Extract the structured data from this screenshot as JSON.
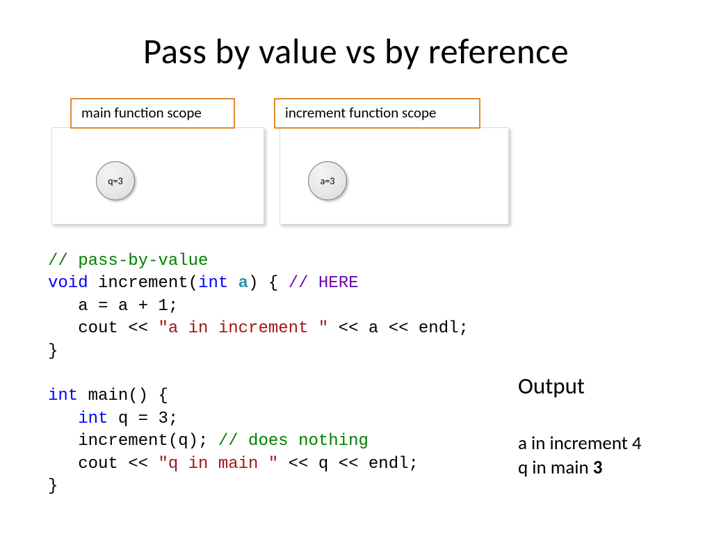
{
  "title": "Pass by value vs by reference",
  "scope_left": {
    "label": "main function scope",
    "var": "q=3"
  },
  "scope_right": {
    "label": "increment function scope",
    "var": "a=3"
  },
  "code": {
    "comment_pbv": "// pass-by-value",
    "kw_void": "void",
    "fn_increment": " increment(",
    "kw_int_a": "int",
    "param_a": " a",
    "paren_open": ") { ",
    "comment_here": "// HERE",
    "line_assign": "   a = a + 1;",
    "line_cout1a": "   cout << ",
    "line_cout1str": "\"a in increment \"",
    "line_cout1b": " << a << endl;",
    "brace1": "}",
    "kw_int_main": "int",
    "fn_main": " main() {",
    "line_intq_a": "   ",
    "line_intq_kw": "int",
    "line_intq_b": " q = 3;",
    "line_call_a": "   increment(q); ",
    "line_call_c": "// does nothing",
    "line_cout2a": "   cout << ",
    "line_cout2str": "\"q in main \"",
    "line_cout2b": " << q << endl;",
    "brace2": "}"
  },
  "output": {
    "title": "Output",
    "line1_text": "a in increment ",
    "line1_val": "4",
    "line2_text": "q in main ",
    "line2_val": "3"
  }
}
